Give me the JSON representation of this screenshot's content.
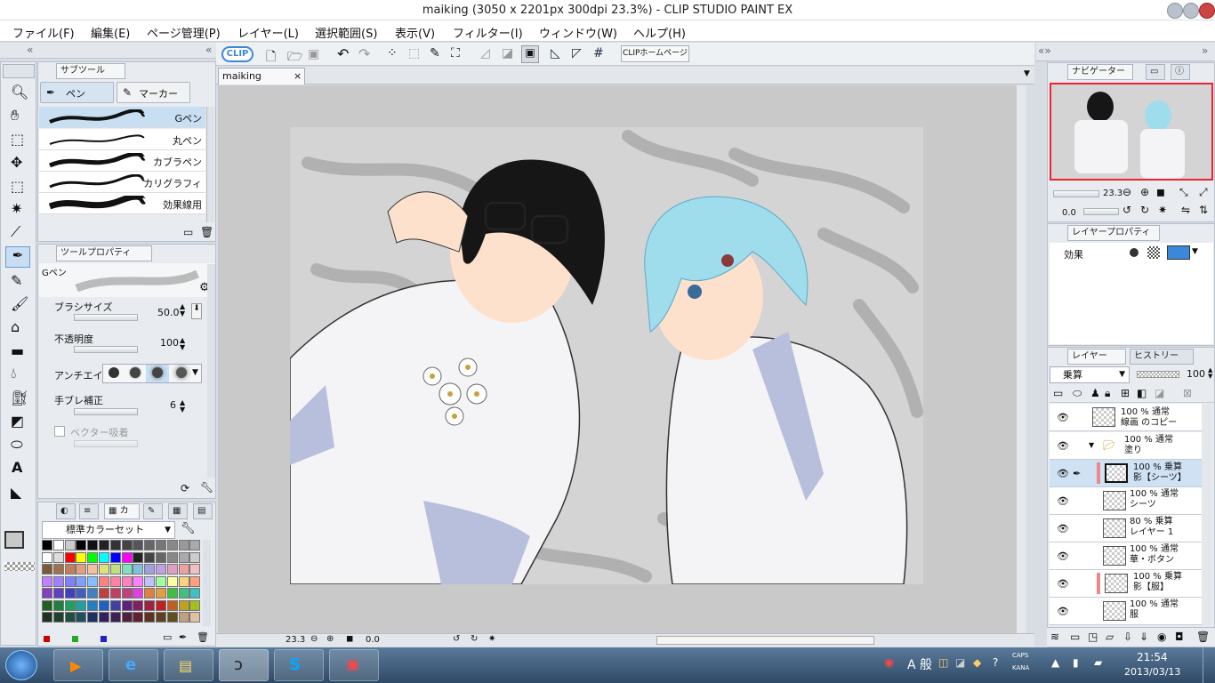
{
  "window": {
    "title": "maiking (3050 x 2201px 300dpi 23.3%)  - CLIP STUDIO PAINT EX"
  },
  "menu": [
    "ファイル(F)",
    "編集(E)",
    "ページ管理(P)",
    "レイヤー(L)",
    "選択範囲(S)",
    "表示(V)",
    "フィルター(I)",
    "ウィンドウ(W)",
    "ヘルプ(H)"
  ],
  "toolbar": {
    "logo": "CLIP",
    "home_button": "CLIPホームページ"
  },
  "document_tab": {
    "name": "maiking",
    "close": "×"
  },
  "subtool": {
    "panel_title": "サブツール",
    "tabs": [
      "ペン",
      "マーカー"
    ],
    "brushes": [
      "Gペン",
      "丸ペン",
      "カブラペン",
      "カリグラフィ",
      "効果線用"
    ]
  },
  "tool_property": {
    "panel_title": "ツールプロパティ",
    "current": "Gペン",
    "brush_size_label": "ブラシサイズ",
    "brush_size": "50.0",
    "opacity_label": "不透明度",
    "opacity": "100",
    "antialias_label": "アンチエイリ",
    "stabilizer_label": "手ブレ補正",
    "stabilizer": "6",
    "vector_snap_label": "ベクター吸着"
  },
  "color_set": {
    "tab": "カ",
    "name": "標準カラーセット"
  },
  "statusbar": {
    "zoom": "23.3",
    "angle": "0.0"
  },
  "navigator": {
    "title": "ナビゲーター",
    "zoom": "23.3",
    "angle": "0.0"
  },
  "layer_property": {
    "title": "レイヤープロパティ",
    "effect_label": "効果"
  },
  "layers": {
    "tab": "レイヤー",
    "history_tab": "ヒストリー",
    "blend_mode": "乗算",
    "opacity": "100",
    "items": [
      {
        "mode": "100 % 通常",
        "name": "線画 のコピー"
      },
      {
        "mode": "100 % 通常",
        "name": "塗り"
      },
      {
        "mode": "100 % 乗算",
        "name": "影【シーツ】"
      },
      {
        "mode": "100 % 通常",
        "name": "シーツ"
      },
      {
        "mode": "80 % 乗算",
        "name": "レイヤー 1"
      },
      {
        "mode": "100 % 通常",
        "name": "華・ボタン"
      },
      {
        "mode": "100 % 乗算",
        "name": "影【服】"
      },
      {
        "mode": "100 % 通常",
        "name": "服"
      }
    ]
  },
  "taskbar": {
    "ime": "A 般",
    "caps": "CAPS",
    "kana": "KANA",
    "time": "21:54",
    "date": "2013/03/13"
  },
  "colors": {
    "accent": "#3b88d8",
    "selected_row": "#cfe2f4"
  }
}
